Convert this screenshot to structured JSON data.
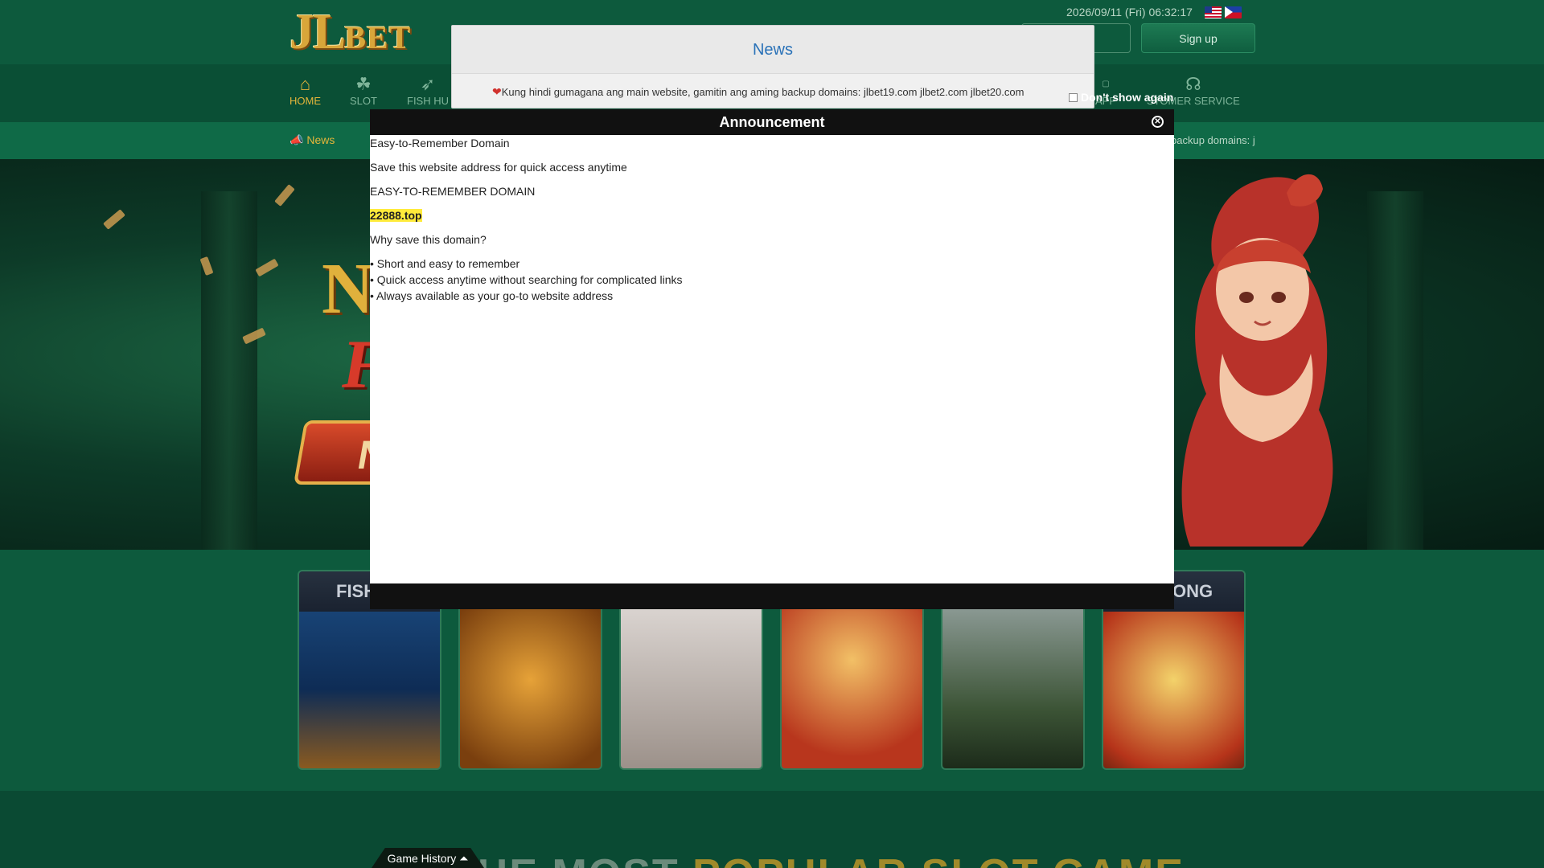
{
  "header": {
    "logo_main": "JL",
    "logo_sub": "BET",
    "datetime": "2026/09/11 (Fri) 06:32:17",
    "signup_label": "Sign up"
  },
  "nav": {
    "items": [
      {
        "label": "HOME",
        "icon": "home-icon"
      },
      {
        "label": "SLOT",
        "icon": "slot-icon"
      },
      {
        "label": "FISH HU",
        "icon": "fish-icon"
      },
      {
        "label": "APP",
        "icon": "app-icon"
      },
      {
        "label": "STOMER SERVICE",
        "icon": "headset-icon"
      }
    ]
  },
  "marquee": {
    "label": "News",
    "tail_text": "backup domains: j"
  },
  "news_popup": {
    "title": "News",
    "message": "Kung hindi gumagana ang main website, gamitin ang aming backup domains: jlbet19.com jlbet2.com jlbet20.com"
  },
  "announcement": {
    "title": "Announcement",
    "dont_show_label": "Don't show again",
    "lines": [
      "Easy-to-Remember Domain",
      "Save this website address for quick access anytime",
      "EASY-TO-REMEMBER DOMAIN",
      "22888.top",
      "Why save this domain?",
      "• Short and easy to remember",
      "• Quick access anytime without searching for complicated links",
      "• Always available as your go-to website address"
    ]
  },
  "hero": {
    "letter_1": "N",
    "letter_2": "F",
    "button_letter": "N"
  },
  "cards": [
    {
      "caption": "FISH"
    },
    {
      "caption": ""
    },
    {
      "caption": ""
    },
    {
      "caption": ""
    },
    {
      "caption": ""
    },
    {
      "caption": "ONG"
    }
  ],
  "footer": {
    "game_history_label": "Game History ⏶",
    "popular_grey": "THE MOST ",
    "popular_gold": "POPULAR SLOT GAME"
  },
  "colors": {
    "brand_green": "#0d5a3d",
    "accent_gold": "#e4b53a",
    "news_blue": "#2a72b8"
  }
}
